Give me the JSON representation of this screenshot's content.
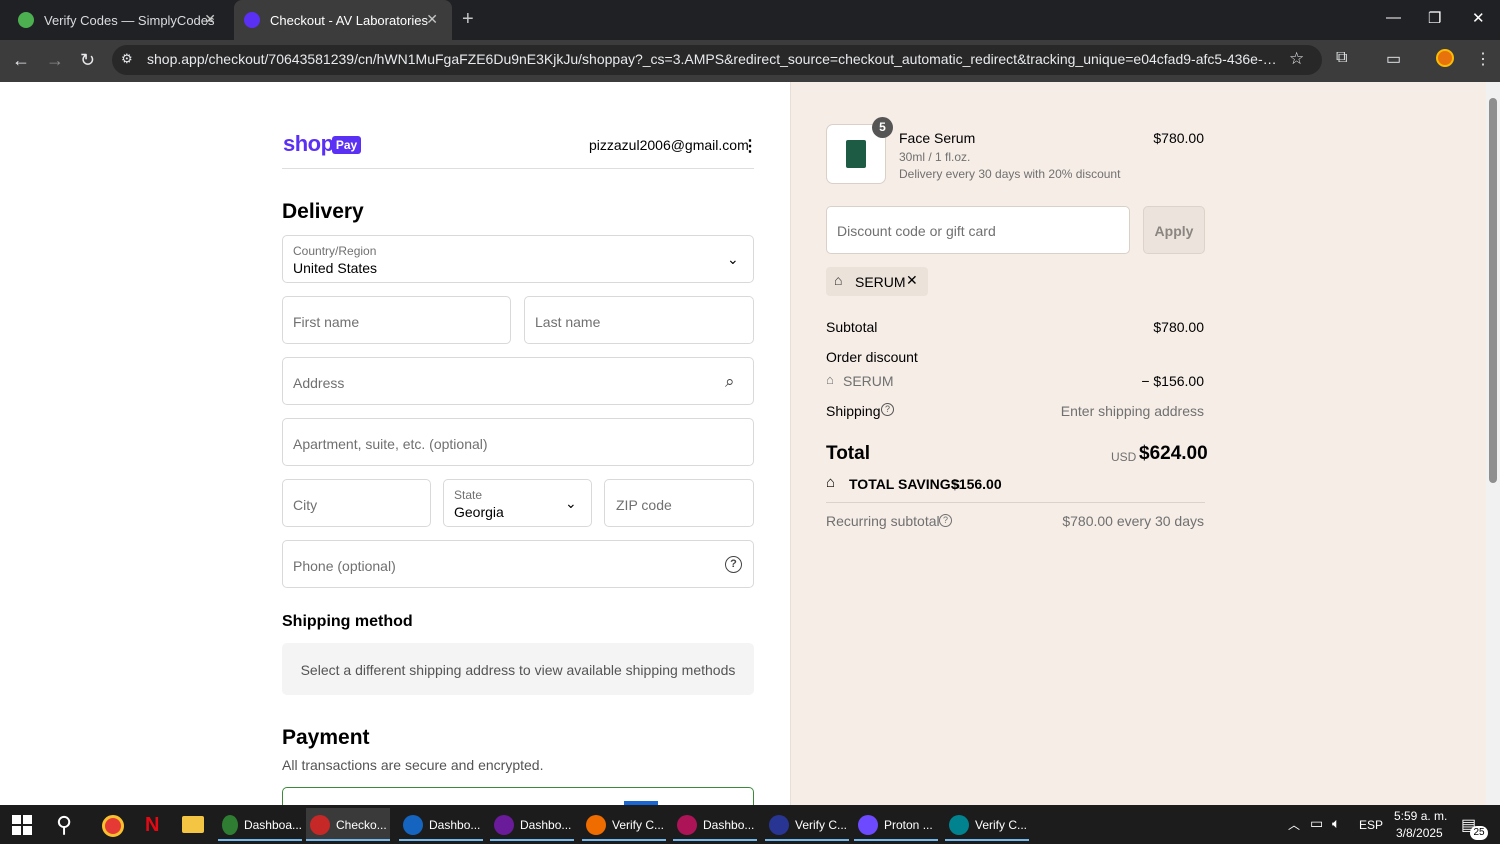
{
  "browser": {
    "tabs": [
      {
        "title": "Verify Codes — SimplyCodes",
        "active": false
      },
      {
        "title": "Checkout - AV Laboratories",
        "active": true
      }
    ],
    "url": "shop.app/checkout/70643581239/cn/hWN1MuFgaFZE6Du9nE3KjkJu/shoppay?_cs=3.AMPS&redirect_source=checkout_automatic_redirect&tracking_unique=e04cfad9-afc5-436e-bbe0-29a5657f..."
  },
  "header": {
    "logo_text": "shop",
    "logo_badge": "Pay",
    "email": "pizzazul2006@gmail.com"
  },
  "delivery": {
    "title": "Delivery",
    "country_label": "Country/Region",
    "country_value": "United States",
    "first_name_placeholder": "First name",
    "last_name_placeholder": "Last name",
    "address_placeholder": "Address",
    "apartment_placeholder": "Apartment, suite, etc. (optional)",
    "city_placeholder": "City",
    "state_label": "State",
    "state_value": "Georgia",
    "zip_placeholder": "ZIP code",
    "phone_placeholder": "Phone (optional)"
  },
  "shipping_method": {
    "title": "Shipping method",
    "message": "Select a different shipping address to view available shipping methods"
  },
  "payment": {
    "title": "Payment",
    "subtitle": "All transactions are secure and encrypted."
  },
  "summary": {
    "product": {
      "quantity": "5",
      "name": "Face Serum",
      "variant": "30ml / 1 fl.oz.",
      "subscription": "Delivery every 30 days with 20% discount",
      "price": "$780.00"
    },
    "discount_placeholder": "Discount code or gift card",
    "apply_label": "Apply",
    "applied_code": "SERUM",
    "subtotal_label": "Subtotal",
    "subtotal_value": "$780.00",
    "order_discount_label": "Order discount",
    "order_discount_code": "SERUM",
    "order_discount_value": "− $156.00",
    "shipping_label": "Shipping",
    "shipping_value": "Enter shipping address",
    "total_label": "Total",
    "total_currency": "USD",
    "total_value": "$624.00",
    "total_savings_label": "TOTAL SAVINGS",
    "total_savings_value": "$156.00",
    "recurring_label": "Recurring subtotal",
    "recurring_value": "$780.00 every 30 days"
  },
  "taskbar": {
    "apps": [
      {
        "label": "Dashboa...",
        "color": "#2e7d32"
      },
      {
        "label": "Checko...",
        "color": "#c62828"
      },
      {
        "label": "Dashbo...",
        "color": "#1565c0"
      },
      {
        "label": "Dashbo...",
        "color": "#6a1b9a"
      },
      {
        "label": "Verify C...",
        "color": "#ef6c00"
      },
      {
        "label": "Dashbo...",
        "color": "#ad1457"
      },
      {
        "label": "Verify C...",
        "color": "#283593"
      },
      {
        "label": "Proton ...",
        "color": "#6d4aff"
      },
      {
        "label": "Verify C...",
        "color": "#00838f"
      }
    ],
    "lang": "ESP",
    "time": "5:59 a. m.",
    "date": "3/8/2025",
    "notifications": "25"
  },
  "colors": {
    "shop_purple": "#5a31f4",
    "summary_bg": "#f5ede6"
  }
}
